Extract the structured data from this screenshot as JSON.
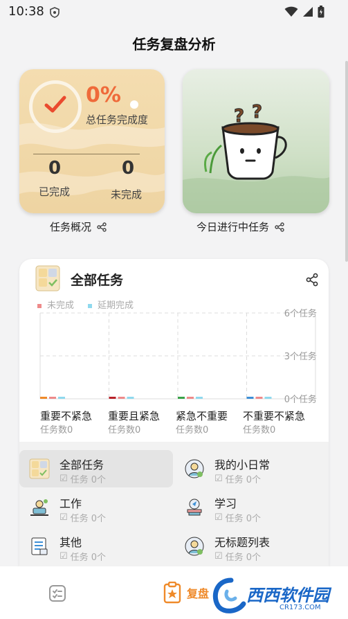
{
  "status_bar": {
    "time": "10:38"
  },
  "page": {
    "title": "任务复盘分析"
  },
  "overview_card": {
    "percent": "0%",
    "total_label": "总任务完成度",
    "done_count": "0",
    "done_label": "已完成",
    "undone_count": "0",
    "undone_label": "未完成",
    "caption": "任务概况"
  },
  "today_card": {
    "caption": "今日进行中任务"
  },
  "all_tasks": {
    "title": "全部任务",
    "legend": [
      {
        "label": "未完成",
        "color": "#ee8a8a"
      },
      {
        "label": "延期完成",
        "color": "#8fd9ee"
      }
    ],
    "y_ticks": [
      "6个任务",
      "3个任务",
      "0个任务"
    ],
    "categories": [
      {
        "name": "重要不紧急",
        "count": "任务数0",
        "color": "#ef8a2a"
      },
      {
        "name": "重要且紧急",
        "count": "任务数0",
        "color": "#b8222a"
      },
      {
        "name": "紧急不重要",
        "count": "任务数0",
        "color": "#3ba34a"
      },
      {
        "name": "不重要不紧急",
        "count": "任务数0",
        "color": "#3d8fd6"
      }
    ]
  },
  "chart_data": {
    "type": "bar",
    "categories": [
      "重要不紧急",
      "重要且紧急",
      "紧急不重要",
      "不重要不紧急"
    ],
    "series": [
      {
        "name": "未完成",
        "values": [
          0,
          0,
          0,
          0
        ]
      },
      {
        "name": "延期完成",
        "values": [
          0,
          0,
          0,
          0
        ]
      }
    ],
    "ylim": [
      0,
      6
    ],
    "y_ticks": [
      "6个任务",
      "3个任务",
      "0个任务"
    ],
    "grid": true,
    "legend": "top-left"
  },
  "task_lists": [
    {
      "name": "全部任务",
      "count": "任务 0个",
      "selected": true
    },
    {
      "name": "我的小日常",
      "count": "任务 0个"
    },
    {
      "name": "工作",
      "count": "任务 0个"
    },
    {
      "name": "学习",
      "count": "任务 0个"
    },
    {
      "name": "其他",
      "count": "任务 0个"
    },
    {
      "name": "无标题列表",
      "count": "任务 0个"
    }
  ],
  "bottom_nav": {
    "review_label": "复盘"
  },
  "watermark": {
    "text": "西西软件园",
    "sub": "CR173.COM"
  },
  "icons": {
    "share": "share-icon",
    "check": "check-icon",
    "coffee": "coffee-cup-icon"
  }
}
